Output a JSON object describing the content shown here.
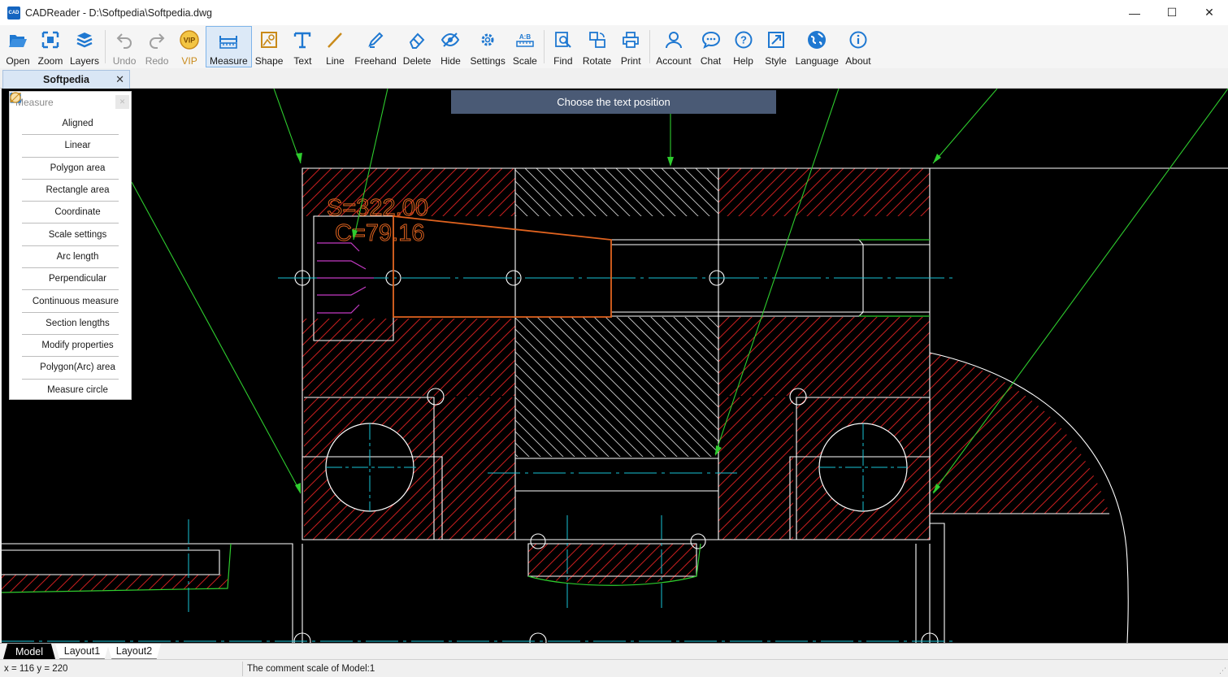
{
  "window": {
    "title": "CADReader - D:\\Softpedia\\Softpedia.dwg",
    "app_icon_text": "CAD",
    "minimize": "—",
    "maximize": "☐",
    "close": "✕"
  },
  "toolbar": {
    "open": "Open",
    "zoom": "Zoom",
    "layers": "Layers",
    "undo": "Undo",
    "redo": "Redo",
    "vip": "VIP",
    "measure": "Measure",
    "shape": "Shape",
    "text": "Text",
    "line": "Line",
    "freehand": "Freehand",
    "delete": "Delete",
    "hide": "Hide",
    "settings": "Settings",
    "scale": "Scale",
    "find": "Find",
    "rotate": "Rotate",
    "print": "Print",
    "account": "Account",
    "chat": "Chat",
    "help": "Help",
    "style": "Style",
    "language": "Language",
    "about": "About"
  },
  "document_tab": {
    "label": "Softpedia",
    "close": "✕"
  },
  "prompt": "Choose the text position",
  "measure_panel": {
    "title": "Measure",
    "close": "✕",
    "items": [
      "Aligned",
      "Linear",
      "Polygon area",
      "Rectangle area",
      "Coordinate",
      "Scale settings",
      "Arc length",
      "Perpendicular",
      "Continuous measure",
      "Section lengths",
      "Modify properties",
      "Polygon(Arc) area",
      "Measure circle"
    ]
  },
  "drawing": {
    "area_label": "S=322.00",
    "perimeter_label": "C=79.16"
  },
  "layout_tabs": [
    "Model",
    "Layout1",
    "Layout2"
  ],
  "status": {
    "coords": "x = 116  y = 220",
    "comment": "The comment scale of Model:1"
  },
  "colors": {
    "accent": "#1f78d1",
    "canvas": "#000000",
    "measure_orange": "#e0631f",
    "hatch_red": "#c81e1e",
    "leader_green": "#2ecc2e",
    "center_cyan": "#19c3d6",
    "magenta": "#c43bc4"
  }
}
